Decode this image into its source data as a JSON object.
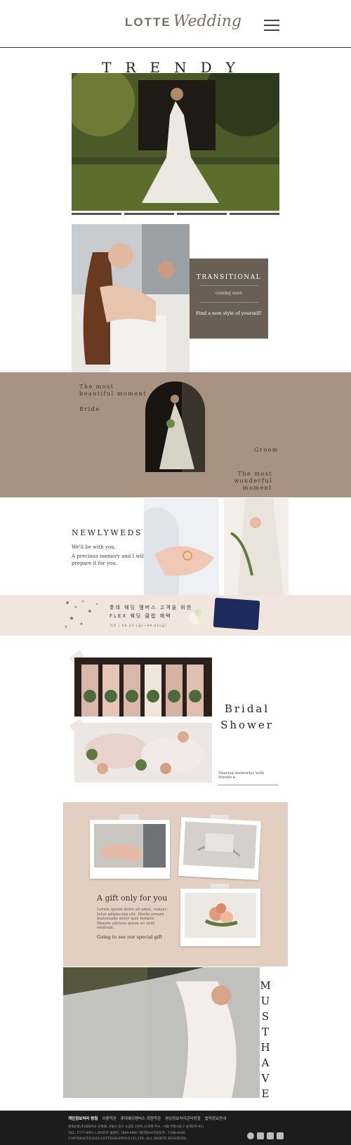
{
  "header": {
    "logo_brand": "LOTTE",
    "logo_word": "Wedding"
  },
  "trendy": {
    "title": "TRENDY"
  },
  "transitional": {
    "title": "TRANSITIONAL",
    "subtitle": "coming soon",
    "cta": "Find a new style of yourself!"
  },
  "moment": {
    "left_line1": "The most",
    "left_line2": "beautiful moment",
    "bride": "Bride",
    "groom": "Groom",
    "right_line1": "The most",
    "right_line2": "wonderful moment"
  },
  "newlyweds": {
    "title": "NEWLYWEDS",
    "line1": "We'll be with you.",
    "line2": "A precious memory and I will prepare it for you."
  },
  "flex_banner": {
    "line1": "롯데 웨딩 멤버스 고객을 위한",
    "line2": "FLEX 웨딩 클럽 혜택",
    "line3": "기간 | 08.22 (금)~09.01(금)"
  },
  "bridal_shower": {
    "title_line1": "Bridal",
    "title_line2": "Shower",
    "link": "Sharing memories with friends ▸"
  },
  "gift": {
    "title": "A gift only for you",
    "description": "Lorem ipsum dolor sit amet, consec-tetur adipiscing elit. Morbi ornare malesuada dolor quis tempor. Mauris ultrices quam eu velit eleifend.",
    "cta": "Going to see our special gift"
  },
  "must_have": {
    "title": "MUSTHAVE"
  },
  "footer": {
    "links": [
      "개인정보처리 방침",
      "이용약관",
      "롯데웨딩멤버스 회원약관",
      "영상정보처리관리방침",
      "법적정보안내"
    ],
    "address": "롯데쇼핑(주)대표이사 강희태, 서울시 중구 소공동 1번지 (도로명 주소 : 서울 특별시중구 남대문로 81)",
    "tel": "TEL: 1577-0001 L.POINT 콜센터: 1899-8900 개인정보보호담당자 : 1588-8100",
    "copyright": "COPYRIGHT©2019 LOTTESHOPPING.CO.,LTD. ALL RIGHTS RESERVED.",
    "sns": [
      "talk-icon",
      "instagram-icon",
      "facebook-icon",
      "app-icon"
    ]
  },
  "colors": {
    "accent_brown": "#a89383",
    "box_brown": "#6a5f55",
    "gift_beige": "#e2cfc1",
    "banner_pink": "#f1e5dd",
    "footer_dark": "#1c1c1c"
  }
}
